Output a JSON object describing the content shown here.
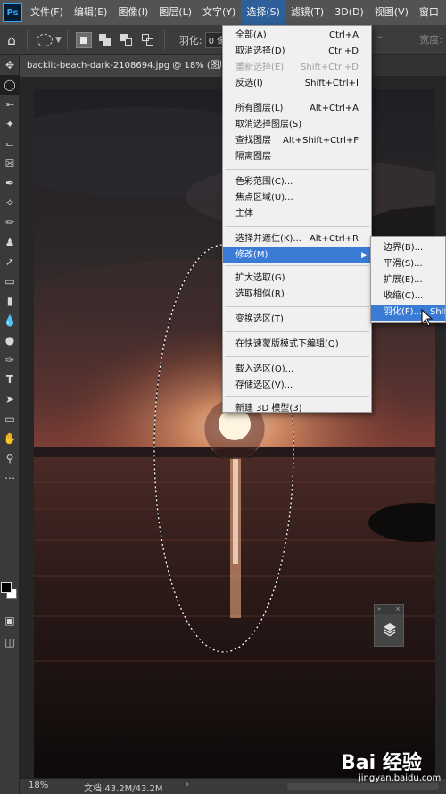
{
  "app": {
    "logo": "Ps"
  },
  "menubar": {
    "items": [
      "文件(F)",
      "编辑(E)",
      "图像(I)",
      "图层(L)",
      "文字(Y)",
      "选择(S)",
      "滤镜(T)",
      "3D(D)",
      "视图(V)",
      "窗口"
    ],
    "active_index": 5
  },
  "options": {
    "feather_label": "羽化:",
    "feather_value": "0 像素",
    "width_label": "宽度:"
  },
  "document": {
    "tab_title": "backlit-beach-dark-2108694.jpg @ 18% (图层"
  },
  "select_menu": {
    "items": [
      {
        "label": "全部(A)",
        "shortcut": "Ctrl+A"
      },
      {
        "label": "取消选择(D)",
        "shortcut": "Ctrl+D"
      },
      {
        "label": "重新选择(E)",
        "shortcut": "Shift+Ctrl+D",
        "disabled": true
      },
      {
        "label": "反选(I)",
        "shortcut": "Shift+Ctrl+I"
      },
      {
        "label": "所有图层(L)",
        "shortcut": "Alt+Ctrl+A"
      },
      {
        "label": "取消选择图层(S)",
        "shortcut": ""
      },
      {
        "label": "查找图层",
        "shortcut": "Alt+Shift+Ctrl+F"
      },
      {
        "label": "隔离图层",
        "shortcut": ""
      },
      {
        "label": "色彩范围(C)...",
        "shortcut": ""
      },
      {
        "label": "焦点区域(U)...",
        "shortcut": ""
      },
      {
        "label": "主体",
        "shortcut": ""
      },
      {
        "label": "选择并遮住(K)...",
        "shortcut": "Alt+Ctrl+R"
      },
      {
        "label": "修改(M)",
        "shortcut": "",
        "submenu": true,
        "highlighted": true
      },
      {
        "label": "扩大选取(G)",
        "shortcut": ""
      },
      {
        "label": "选取相似(R)",
        "shortcut": ""
      },
      {
        "label": "变换选区(T)",
        "shortcut": ""
      },
      {
        "label": "在快速蒙版模式下编辑(Q)",
        "shortcut": ""
      },
      {
        "label": "载入选区(O)...",
        "shortcut": ""
      },
      {
        "label": "存储选区(V)...",
        "shortcut": ""
      },
      {
        "label": "新建 3D 模型(3)",
        "shortcut": ""
      }
    ]
  },
  "modify_submenu": {
    "items": [
      {
        "label": "边界(B)...",
        "shortcut": ""
      },
      {
        "label": "平滑(S)...",
        "shortcut": ""
      },
      {
        "label": "扩展(E)...",
        "shortcut": ""
      },
      {
        "label": "收缩(C)...",
        "shortcut": ""
      },
      {
        "label": "羽化(F)...",
        "shortcut": "Shift",
        "highlighted": true
      }
    ]
  },
  "status": {
    "zoom": "18%",
    "doc_info": "文档:43.2M/43.2M"
  },
  "watermark": {
    "logo_text": "Bai 经验",
    "site": "jingyan.baidu.com"
  },
  "colors": {
    "menu_highlight": "#3a7bd5",
    "foreground": "#000000",
    "background": "#ffffff"
  }
}
